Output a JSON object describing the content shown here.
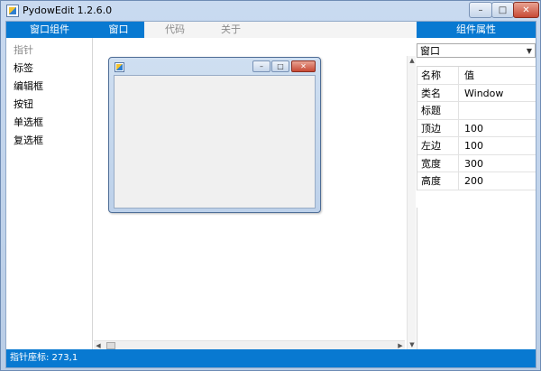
{
  "window": {
    "title": "PydowEdit 1.2.6.0",
    "controls": {
      "minimize": "–",
      "maximize": "□",
      "close": "✕"
    }
  },
  "topbar": {
    "left_label": "窗口组件",
    "tabs": [
      {
        "label": "窗口",
        "active": true
      },
      {
        "label": "代码",
        "active": false
      },
      {
        "label": "关于",
        "active": false
      }
    ],
    "right_label": "组件属性"
  },
  "palette": {
    "items": [
      {
        "label": "指针",
        "selected": true
      },
      {
        "label": "标签",
        "selected": false
      },
      {
        "label": "编辑框",
        "selected": false
      },
      {
        "label": "按钮",
        "selected": false
      },
      {
        "label": "单选框",
        "selected": false
      },
      {
        "label": "复选框",
        "selected": false
      }
    ]
  },
  "form_preview": {
    "controls": {
      "minimize": "–",
      "maximize": "□",
      "close": "✕"
    }
  },
  "properties": {
    "selector_value": "窗口",
    "header": {
      "name": "名称",
      "value": "值"
    },
    "rows": [
      {
        "name": "类名",
        "value": "Window"
      },
      {
        "name": "标题",
        "value": ""
      },
      {
        "name": "顶边",
        "value": "100"
      },
      {
        "name": "左边",
        "value": "100"
      },
      {
        "name": "宽度",
        "value": "300"
      },
      {
        "name": "高度",
        "value": "200"
      }
    ]
  },
  "status": {
    "text": "指针座标: 273,1"
  },
  "icons": {
    "app_icon": "app-icon",
    "dropdown": "chevron-down-icon",
    "scroll_left": "scroll-left-arrow",
    "scroll_right": "scroll-right-arrow",
    "scroll_up": "scroll-up-arrow",
    "scroll_down": "scroll-down-arrow"
  },
  "colors": {
    "accent": "#0879d1",
    "tab_inactive_text": "#8a8a8a",
    "form_client": "#f0f0f0"
  }
}
